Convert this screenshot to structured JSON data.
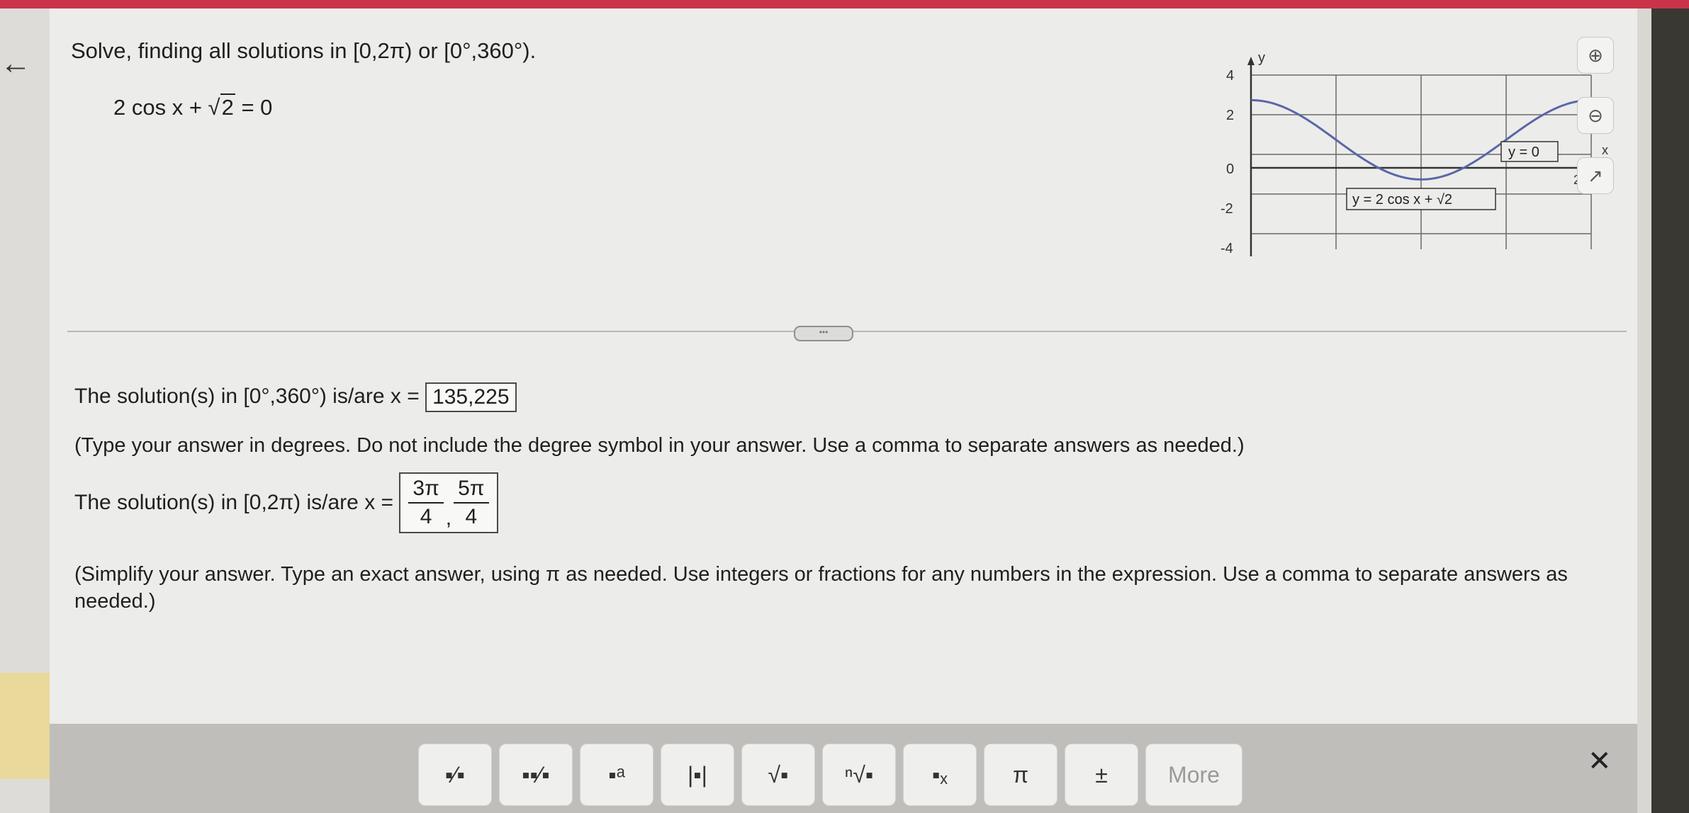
{
  "problem": {
    "instruction": "Solve, finding all solutions in [0,2π) or [0°,360°).",
    "eq_lhs": "2 cos x +",
    "eq_rad": "2",
    "eq_rhs": "= 0"
  },
  "graph": {
    "y_axis_label": "y",
    "x_axis_label": "x",
    "y_ticks": [
      "4",
      "2",
      "0",
      "-2",
      "-4"
    ],
    "x_end_label": "2π",
    "curve_label": "y = 2 cos x + √2",
    "line_label": "y = 0",
    "curve_color": "#5a66a8",
    "y_range": [
      -4,
      4
    ],
    "x_range_description": "[0, 2π]"
  },
  "toolbox": {
    "zoom_in": "zoom-in",
    "zoom_out": "zoom-out",
    "popout": "popout"
  },
  "divider": {
    "handle": "•••"
  },
  "answers": {
    "degrees_prefix": "The solution(s) in [0°,360°) is/are x =",
    "degrees_value": "135,225",
    "degrees_instructions": "(Type your answer in degrees. Do not include the degree symbol in your answer. Use a comma to separate answers as needed.)",
    "radians_prefix": "The solution(s) in [0,2π) is/are x =",
    "radians_frac1_num": "3π",
    "radians_frac1_den": "4",
    "radians_sep": ",",
    "radians_frac2_num": "5π",
    "radians_frac2_den": "4",
    "radians_instructions": "(Simplify your answer. Type an exact answer, using π as needed. Use integers or fractions for any numbers in the expression. Use a comma to separate answers as needed.)"
  },
  "toolbar": {
    "buttons": [
      {
        "name": "fraction",
        "glyph": "▪⁄▪"
      },
      {
        "name": "mixed-number",
        "glyph": "▪▪⁄▪"
      },
      {
        "name": "exponent",
        "glyph": "▪ᵃ"
      },
      {
        "name": "absolute-value",
        "glyph": "|▪|"
      },
      {
        "name": "square-root",
        "glyph": "√▪"
      },
      {
        "name": "nth-root",
        "glyph": "ⁿ√▪"
      },
      {
        "name": "subscript",
        "glyph": "▪ₓ"
      },
      {
        "name": "pi",
        "glyph": "π"
      },
      {
        "name": "plus-minus",
        "glyph": "±"
      }
    ],
    "more_label": "More",
    "close_glyph": "✕"
  }
}
